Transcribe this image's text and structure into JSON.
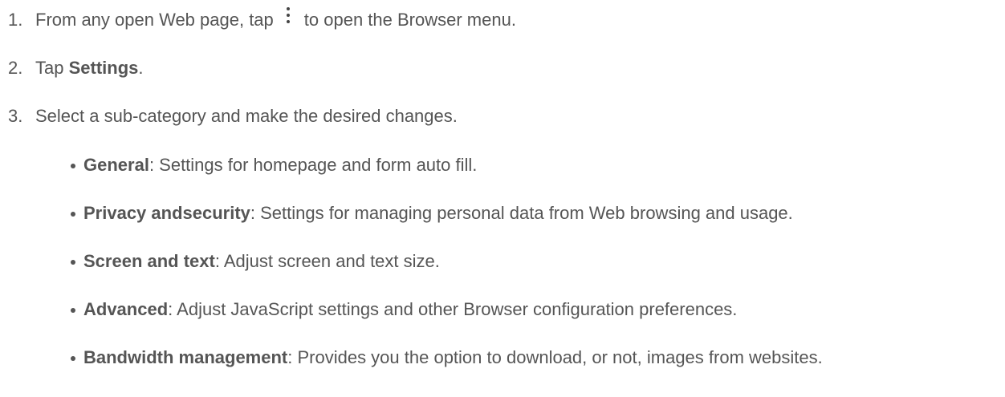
{
  "steps": [
    {
      "num": "1.",
      "before_icon": "From any open Web page, tap",
      "icon": "more-vertical-icon",
      "after_icon": "to open the Browser menu."
    },
    {
      "num": "2.",
      "before_bold": "Tap ",
      "bold": "Settings",
      "after_bold": "."
    },
    {
      "num": "3.",
      "text": "Select a sub-category and make the desired changes."
    }
  ],
  "bullets": [
    {
      "term": "General",
      "desc": ": Settings for homepage and form auto fill."
    },
    {
      "term": "Privacy andsecurity",
      "desc": ": Settings for managing personal data from Web browsing and usage."
    },
    {
      "term": "Screen and text",
      "desc": ": Adjust screen and text size."
    },
    {
      "term": "Advanced",
      "desc": ": Adjust JavaScript settings and other Browser configuration preferences."
    },
    {
      "term": "Bandwidth management",
      "desc": ": Provides you the option to download, or not, images from websites."
    }
  ],
  "colors": {
    "text": "#555555",
    "icon": "#444444",
    "background": "#ffffff"
  }
}
